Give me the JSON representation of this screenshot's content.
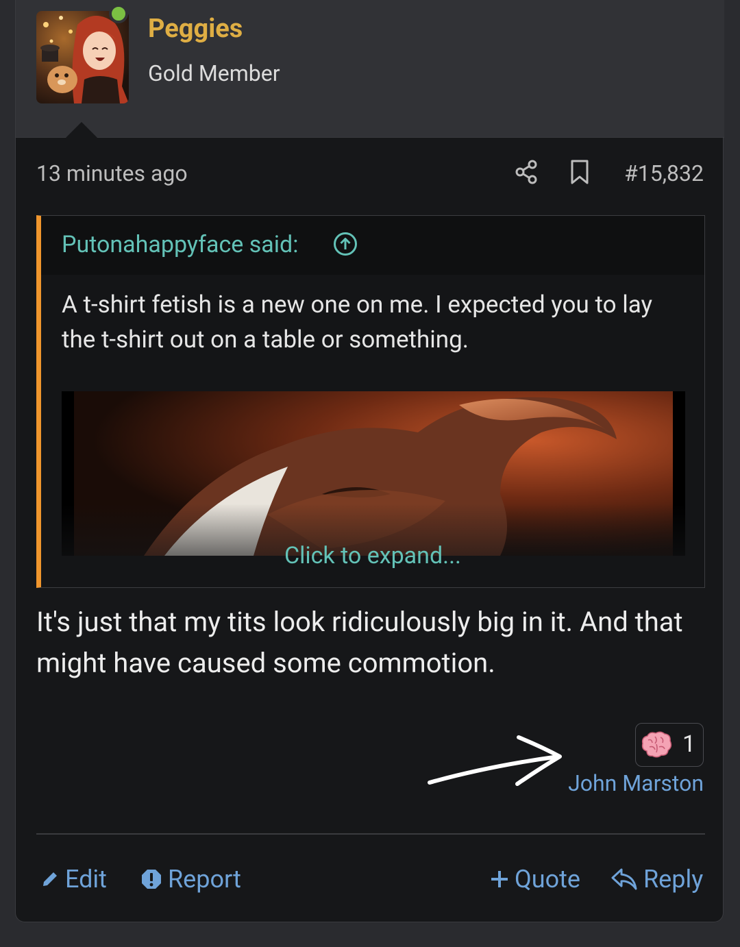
{
  "user": {
    "name": "Peggies",
    "title": "Gold Member",
    "online": true
  },
  "post": {
    "time": "13 minutes ago",
    "number": "#15,832",
    "body": "It's just that my tits look ridiculously big in it. And that might have caused some commotion."
  },
  "quote": {
    "attribution": "Putonahappyface said:",
    "text": "A t-shirt fetish is a new one on me. I expected you to lay the t-shirt out on a table or something.",
    "expand_label": "Click to expand..."
  },
  "reaction": {
    "icon": "brain-icon",
    "count": "1",
    "user": "John Marston"
  },
  "actions": {
    "edit": "Edit",
    "report": "Report",
    "quote": "Quote",
    "reply": "Reply"
  },
  "colors": {
    "username": "#dfae44",
    "link": "#6fa3d9",
    "quote_accent": "#f0962d",
    "quote_link": "#63c2b7",
    "online": "#7bc043"
  }
}
